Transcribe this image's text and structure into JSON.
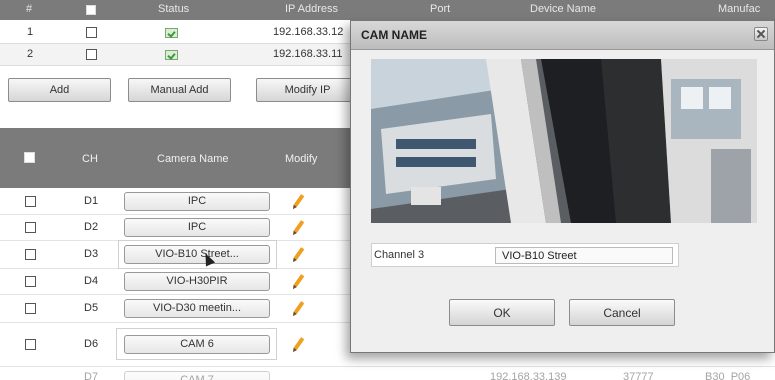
{
  "device_table": {
    "header": [
      "#",
      "",
      "Status",
      "IP Address",
      "Port",
      "Device Name",
      "Manufac"
    ],
    "rows": [
      {
        "num": "1",
        "ip": "192.168.33.12"
      },
      {
        "num": "2",
        "ip": "192.168.33.11"
      }
    ]
  },
  "toolbar": {
    "add_label": "Add",
    "manual_add_label": "Manual Add",
    "modify_ip_label": "Modify IP"
  },
  "camera_table": {
    "columns": {
      "ch": "CH",
      "name": "Camera Name",
      "modify": "Modify"
    },
    "rows": [
      {
        "ch": "D1",
        "name": "IPC"
      },
      {
        "ch": "D2",
        "name": "IPC"
      },
      {
        "ch": "D3",
        "name": "VIO-B10 Street..."
      },
      {
        "ch": "D4",
        "name": "VIO-H30PIR"
      },
      {
        "ch": "D5",
        "name": "VIO-D30 meetin..."
      },
      {
        "ch": "D6",
        "name": "CAM 6"
      }
    ],
    "partial_row": {
      "ch": "D7",
      "name": "CAM 7",
      "ip": "192.168.33.139",
      "port": "37777",
      "model": "B30_P06"
    }
  },
  "dialog": {
    "title": "CAM NAME",
    "channel_label": "Channel 3",
    "name_value": "VIO-B10 Street",
    "ok_label": "OK",
    "cancel_label": "Cancel"
  },
  "colors": {
    "header_bg": "#7b7b7b",
    "dialog_bg": "#efefef",
    "pencil": "#f0a020",
    "status_ok": "#3b9a3b"
  }
}
